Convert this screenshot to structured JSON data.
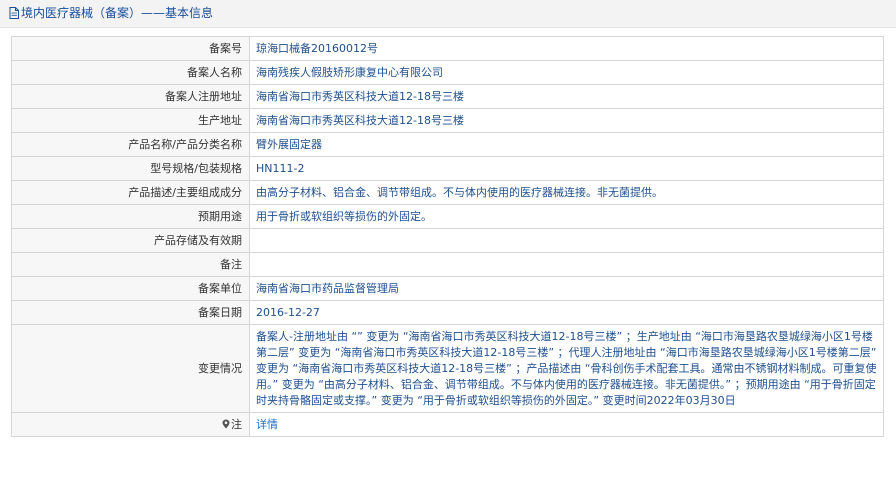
{
  "header": {
    "title": "境内医疗器械（备案）——基本信息",
    "icon": "document-icon"
  },
  "rows": [
    {
      "label": "备案号",
      "value": "琼海口械备20160012号"
    },
    {
      "label": "备案人名称",
      "value": "海南残疾人假肢矫形康复中心有限公司"
    },
    {
      "label": "备案人注册地址",
      "value": "海南省海口市秀英区科技大道12-18号三楼"
    },
    {
      "label": "生产地址",
      "value": "海南省海口市秀英区科技大道12-18号三楼"
    },
    {
      "label": "产品名称/产品分类名称",
      "value": "臂外展固定器"
    },
    {
      "label": "型号规格/包装规格",
      "value": "HN111-2"
    },
    {
      "label": "产品描述/主要组成成分",
      "value": "由高分子材料、铝合金、调节带组成。不与体内使用的医疗器械连接。非无菌提供。"
    },
    {
      "label": "预期用途",
      "value": "用于骨折或软组织等损伤的外固定。"
    },
    {
      "label": "产品存储及有效期",
      "value": ""
    },
    {
      "label": "备注",
      "value": ""
    },
    {
      "label": "备案单位",
      "value": "海南省海口市药品监督管理局"
    },
    {
      "label": "备案日期",
      "value": "2016-12-27"
    }
  ],
  "change": {
    "label": "变更情况",
    "value": "备案人-注册地址由 “” 变更为 “海南省海口市秀英区科技大道12-18号三楼” ；生产地址由 “海口市海垦路农垦城绿海小区1号楼第二层” 变更为 “海南省海口市秀英区科技大道12-18号三楼” ；代理人注册地址由 “海口市海垦路农垦城绿海小区1号楼第二层” 变更为 “海南省海口市秀英区科技大道12-18号三楼” ；产品描述由 “骨科创伤手术配套工具。通常由不锈钢材料制成。可重复使用。” 变更为 “由高分子材料、铝合金、调节带组成。不与体内使用的医疗器械连接。非无菌提供。” ；预期用途由 “用于骨折固定时夹持骨骼固定或支撑。” 变更为 “用于骨折或软组织等损伤的外固定。” 变更时间2022年03月30日"
  },
  "note": {
    "label": "注",
    "icon": "location-pin-icon",
    "link_text": "详情"
  },
  "colors": {
    "title": "#1a4f9c",
    "value_text": "#1f4f8f",
    "link": "#1e6fc8",
    "label_bg": "#f7f7f7",
    "border": "#d6d6d6"
  }
}
